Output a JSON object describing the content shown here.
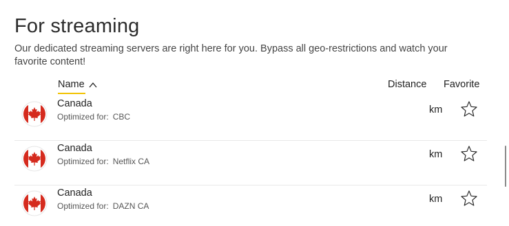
{
  "section": {
    "title": "For streaming",
    "description": "Our dedicated streaming servers are right here for you. Bypass all geo-restrictions and watch your favorite content!"
  },
  "columns": {
    "name": "Name",
    "distance": "Distance",
    "favorite": "Favorite"
  },
  "colors": {
    "accent_underline": "#f2c200",
    "flag_red": "#d52b1e"
  },
  "servers": [
    {
      "country": "Canada",
      "optimized_label": "Optimized for:",
      "service": "CBC",
      "distance_unit": "km",
      "flag_icon": "canada-flag-icon",
      "favorite_icon": "star-outline-icon"
    },
    {
      "country": "Canada",
      "optimized_label": "Optimized for:",
      "service": "Netflix CA",
      "distance_unit": "km",
      "flag_icon": "canada-flag-icon",
      "favorite_icon": "star-outline-icon"
    },
    {
      "country": "Canada",
      "optimized_label": "Optimized for:",
      "service": "DAZN CA",
      "distance_unit": "km",
      "flag_icon": "canada-flag-icon",
      "favorite_icon": "star-outline-icon"
    }
  ]
}
